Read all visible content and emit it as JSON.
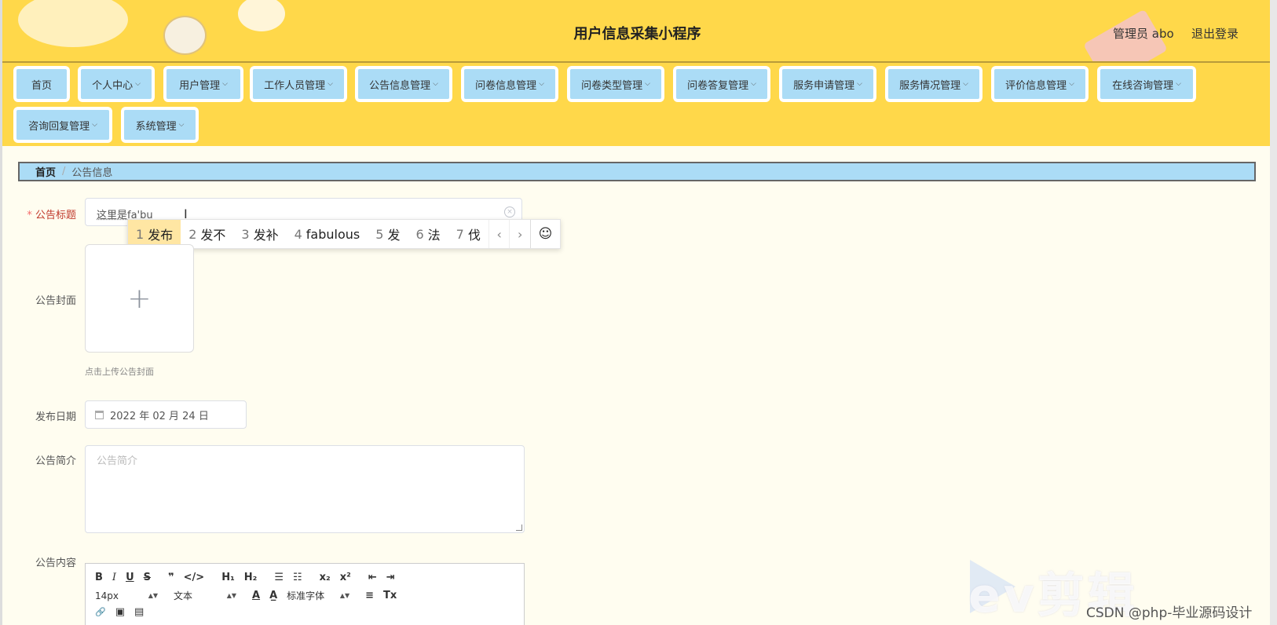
{
  "header": {
    "title": "用户信息采集小程序",
    "admin": "管理员 abo",
    "logout": "退出登录"
  },
  "nav": [
    {
      "label": "首页",
      "chev": ""
    },
    {
      "label": "个人中心",
      "chev": "⌵"
    },
    {
      "label": "用户管理",
      "chev": "⌵"
    },
    {
      "label": "工作人员管理",
      "chev": "⌵"
    },
    {
      "label": "公告信息管理",
      "chev": "⌵"
    },
    {
      "label": "问卷信息管理",
      "chev": "⌵"
    },
    {
      "label": "问卷类型管理",
      "chev": "⌵"
    },
    {
      "label": "问卷答复管理",
      "chev": "⌵"
    },
    {
      "label": "服务申请管理",
      "chev": "⌵"
    },
    {
      "label": "服务情况管理",
      "chev": "⌵"
    },
    {
      "label": "评价信息管理",
      "chev": "⌵"
    },
    {
      "label": "在线咨询管理",
      "chev": "⌵"
    },
    {
      "label": "咨询回复管理",
      "chev": "⌵"
    },
    {
      "label": "系统管理",
      "chev": "⌵"
    }
  ],
  "breadcrumb": {
    "home": "首页",
    "separator": "/",
    "current": "公告信息"
  },
  "form": {
    "title_label": "公告标题",
    "required_mark": "*",
    "title_value": "这里是fa'bu",
    "cover_label": "公告封面",
    "upload_plus": "+",
    "upload_hint": "点击上传公告封面",
    "date_label": "发布日期",
    "date_value": "2022 年 02 月 24 日",
    "intro_label": "公告简介",
    "intro_placeholder": "公告简介",
    "content_label": "公告内容"
  },
  "ime": {
    "candidates": [
      {
        "n": "1",
        "text": "发布"
      },
      {
        "n": "2",
        "text": "发不"
      },
      {
        "n": "3",
        "text": "发补"
      },
      {
        "n": "4",
        "text": "fabulous"
      },
      {
        "n": "5",
        "text": "发"
      },
      {
        "n": "6",
        "text": "法"
      },
      {
        "n": "7",
        "text": "伐"
      }
    ],
    "prev": "‹",
    "next": "›",
    "emoji": "☺"
  },
  "editor": {
    "row1": [
      "B",
      "I",
      "U",
      "S",
      "❞",
      "</>",
      "H₁",
      "H₂",
      "☰",
      "☷",
      "x₂",
      "x²",
      "⇤",
      "⇥"
    ],
    "size": "14px",
    "text_type": "文本",
    "font": "标准字体",
    "row2_icons": [
      "A",
      "A̲",
      "≡",
      "Tx"
    ],
    "row3": [
      "🔗",
      "▣",
      "▤"
    ]
  },
  "watermark": {
    "brand": "ev剪辑",
    "csdn": "CSDN @php-毕业源码设计"
  }
}
